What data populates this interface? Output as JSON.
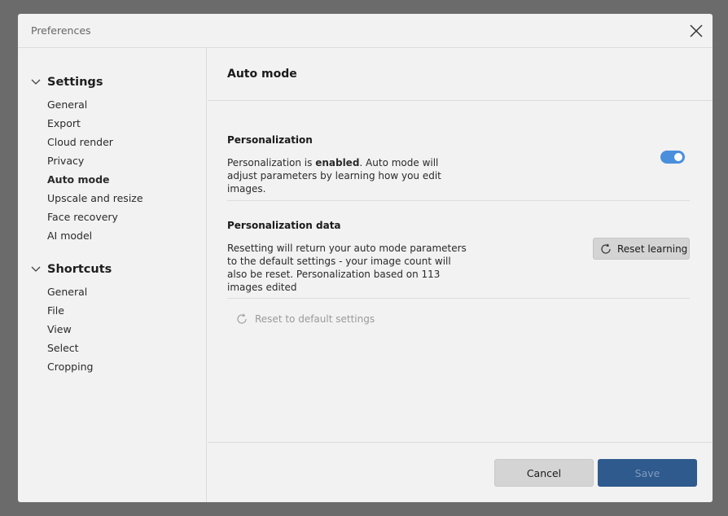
{
  "window": {
    "title": "Preferences"
  },
  "sidebar": {
    "groups": [
      {
        "label": "Settings",
        "items": [
          "General",
          "Export",
          "Cloud render",
          "Privacy",
          "Auto mode",
          "Upscale and resize",
          "Face recovery",
          "AI model"
        ]
      },
      {
        "label": "Shortcuts",
        "items": [
          "General",
          "File",
          "View",
          "Select",
          "Cropping"
        ]
      }
    ],
    "active_item": "Auto mode"
  },
  "main": {
    "heading": "Auto mode",
    "personalization": {
      "title": "Personalization",
      "desc_prefix": "Personalization is ",
      "desc_state": "enabled",
      "desc_suffix": ". Auto mode will adjust parameters by learning how you edit images.",
      "toggle_on": true
    },
    "personalization_data": {
      "title": "Personalization data",
      "desc": "Resetting will return your auto mode parameters to the default settings - your image count will also be reset. Personalization based on 113 images edited",
      "reset_button": "Reset learning"
    },
    "reset_default": "Reset to default settings"
  },
  "footer": {
    "cancel": "Cancel",
    "save": "Save"
  },
  "colors": {
    "accent": "#4a8fdc",
    "primary_button": "#2e5a8e"
  },
  "icons": {
    "close": "close-icon",
    "chevron": "chevron-down-icon",
    "refresh": "refresh-icon"
  }
}
